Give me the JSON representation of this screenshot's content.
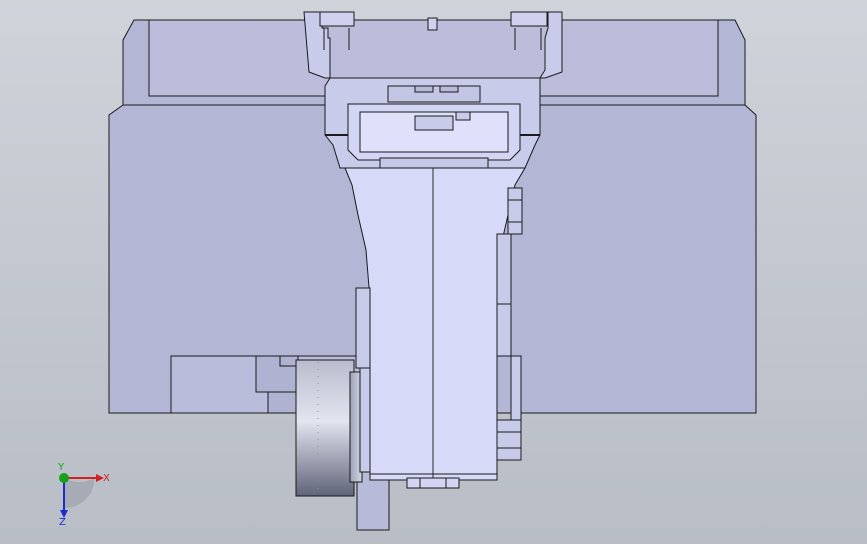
{
  "viewport": {
    "background_top": "#cfd3da",
    "background_bottom": "#b8bdc6"
  },
  "model": {
    "body_fill": "#b4b6d6",
    "plate_fill": "#bcbedd",
    "arm_fill": "#d6d8f7",
    "edge_color": "#1a1a1a",
    "roller_dark": "#6e7387",
    "roller_light": "#d8dbea"
  },
  "triad": {
    "x_label": "X",
    "y_label": "Y",
    "z_label": "Z",
    "x_color": "#d22020",
    "y_color": "#18a018",
    "z_color": "#1c2ad0"
  }
}
